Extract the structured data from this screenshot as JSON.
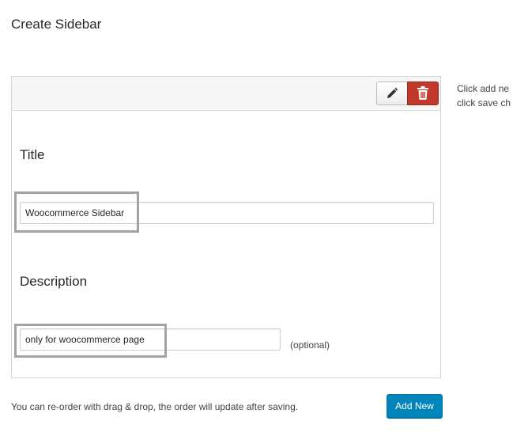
{
  "page": {
    "heading": "Create Sidebar"
  },
  "panel": {
    "toolbar": {
      "edit_icon": "pencil-icon",
      "delete_icon": "trash-icon",
      "delete_color": "#c0392b"
    },
    "title": {
      "label": "Title",
      "value": "Woocommerce Sidebar"
    },
    "description": {
      "label": "Description",
      "value": "only for woocommerce page",
      "note": "(optional)"
    }
  },
  "help": {
    "line1": "Click add ne",
    "line2": "click save ch"
  },
  "footer": {
    "note": "You can re-order with drag & drop, the order will update after saving.",
    "add_new_label": "Add New",
    "accent": "#0085ba"
  }
}
